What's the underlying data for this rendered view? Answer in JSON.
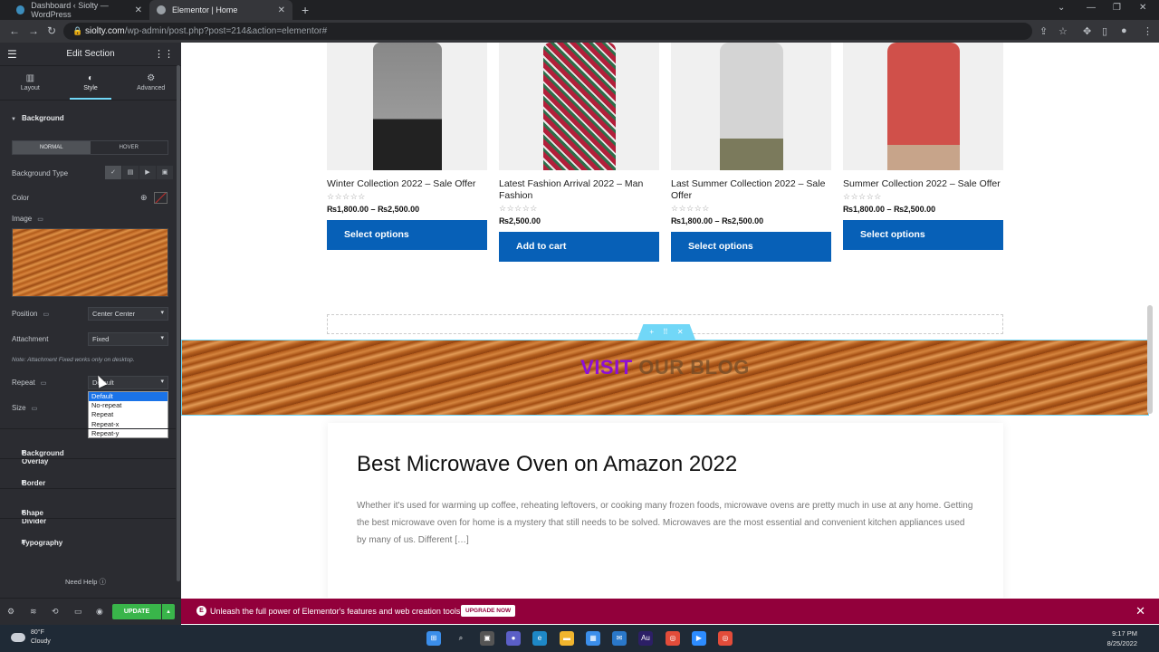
{
  "browser": {
    "tabs": [
      {
        "title": "Dashboard ‹ Siolty — WordPress"
      },
      {
        "title": "Elementor | Home"
      }
    ],
    "url_host": "siolty.com",
    "url_path": "/wp-admin/post.php?post=214&action=elementor#"
  },
  "panel": {
    "title": "Edit Section",
    "tabs": [
      {
        "label": "Layout",
        "icon": "layout-icon"
      },
      {
        "label": "Style",
        "icon": "style-icon"
      },
      {
        "label": "Advanced",
        "icon": "gear-icon"
      }
    ],
    "background_section": "Background",
    "toggle": {
      "normal": "NORMAL",
      "hover": "HOVER"
    },
    "labels": {
      "background_type": "Background Type",
      "color": "Color",
      "image": "Image",
      "position": "Position",
      "attachment": "Attachment",
      "repeat": "Repeat",
      "size": "Size"
    },
    "position_value": "Center Center",
    "attachment_value": "Fixed",
    "attachment_note": "Note: Attachment Fixed works only on desktop.",
    "repeat_value": "Default",
    "repeat_options": [
      "Default",
      "No-repeat",
      "Repeat",
      "Repeat-x",
      "Repeat-y"
    ],
    "accordions": [
      "Background Overlay",
      "Border",
      "Shape Divider",
      "Typography"
    ],
    "need_help": "Need Help",
    "update_label": "UPDATE"
  },
  "products": [
    {
      "title": "Winter Collection 2022 – Sale Offer",
      "price": "₨1,800.00 – ₨2,500.00",
      "button": "Select options"
    },
    {
      "title": "Latest Fashion Arrival 2022 – Man Fashion",
      "price": "₨2,500.00",
      "button": "Add to cart"
    },
    {
      "title": "Last Summer Collection 2022 – Sale Offer",
      "price": "₨1,800.00 – ₨2,500.00",
      "button": "Select options"
    },
    {
      "title": "Summer Collection 2022 – Sale Offer",
      "price": "₨1,800.00 – ₨2,500.00",
      "button": "Select options"
    }
  ],
  "banner": {
    "word1": "VISIT",
    "word2": "OUR BLOG"
  },
  "post": {
    "title": "Best Microwave Oven on Amazon 2022",
    "excerpt": "Whether it's used for warming up coffee, reheating leftovers, or cooking many frozen foods, microwave ovens are pretty much in use at any home. Getting the best microwave oven for home is a mystery that still needs to be solved. Microwaves are the most essential and convenient kitchen appliances used by many of us. Different […]"
  },
  "promo": {
    "message": "Unleash the full power of Elementor's features and web creation tools.",
    "button": "UPGRADE NOW"
  },
  "taskbar": {
    "temp": "80°F",
    "condition": "Cloudy",
    "time": "9:17 PM",
    "date": "8/25/2022"
  },
  "colors": {
    "accent": "#71d7f7",
    "button_blue": "#0760b7",
    "update_green": "#39b54a",
    "promo": "#92003b",
    "banner_text": "#8d0fd6"
  }
}
